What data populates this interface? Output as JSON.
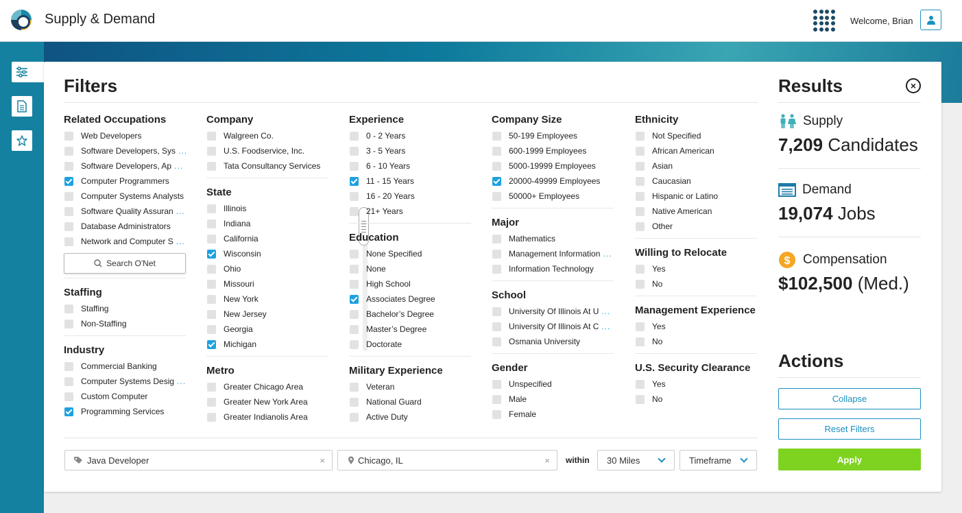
{
  "header": {
    "title": "Supply & Demand",
    "welcome": "Welcome, Brian"
  },
  "filters": {
    "title": "Filters",
    "related_occupations": {
      "title": "Related Occupations",
      "items": [
        {
          "label": "Web Developers",
          "checked": false,
          "more": ""
        },
        {
          "label": "Software Developers, Sys",
          "checked": false,
          "more": "..."
        },
        {
          "label": "Software Developers, Ap",
          "checked": false,
          "more": "..."
        },
        {
          "label": "Computer Programmers",
          "checked": true,
          "more": ""
        },
        {
          "label": "Computer Systems Analysts",
          "checked": false,
          "more": ""
        },
        {
          "label": "Software Quality Assuran",
          "checked": false,
          "more": "..."
        },
        {
          "label": "Database Administrators",
          "checked": false,
          "more": ""
        },
        {
          "label": "Network and Computer S",
          "checked": false,
          "more": "..."
        }
      ],
      "search_label": "Search O'Net"
    },
    "staffing": {
      "title": "Staffing",
      "items": [
        {
          "label": "Staffing",
          "checked": false,
          "more": ""
        },
        {
          "label": "Non-Staffing",
          "checked": false,
          "more": ""
        }
      ]
    },
    "industry": {
      "title": "Industry",
      "items": [
        {
          "label": "Commercial Banking",
          "checked": false,
          "more": ""
        },
        {
          "label": "Computer Systems Desig",
          "checked": false,
          "more": "..."
        },
        {
          "label": "Custom Computer",
          "checked": false,
          "more": ""
        },
        {
          "label": "Programming Services",
          "checked": true,
          "more": ""
        }
      ]
    },
    "company": {
      "title": "Company",
      "items": [
        {
          "label": "Walgreen Co.",
          "checked": false,
          "more": ""
        },
        {
          "label": "U.S. Foodservice, Inc.",
          "checked": false,
          "more": ""
        },
        {
          "label": "Tata Consultancy Services",
          "checked": false,
          "more": ""
        }
      ]
    },
    "state": {
      "title": "State",
      "items": [
        {
          "label": "Illinois",
          "checked": false,
          "more": ""
        },
        {
          "label": "Indiana",
          "checked": false,
          "more": ""
        },
        {
          "label": "California",
          "checked": false,
          "more": ""
        },
        {
          "label": "Wisconsin",
          "checked": true,
          "more": ""
        },
        {
          "label": "Ohio",
          "checked": false,
          "more": ""
        },
        {
          "label": "Missouri",
          "checked": false,
          "more": ""
        },
        {
          "label": "New York",
          "checked": false,
          "more": ""
        },
        {
          "label": "New Jersey",
          "checked": false,
          "more": ""
        },
        {
          "label": "Georgia",
          "checked": false,
          "more": ""
        },
        {
          "label": "Michigan",
          "checked": true,
          "more": ""
        }
      ]
    },
    "metro": {
      "title": "Metro",
      "items": [
        {
          "label": "Greater Chicago Area",
          "checked": false,
          "more": ""
        },
        {
          "label": "Greater New York Area",
          "checked": false,
          "more": ""
        },
        {
          "label": "Greater Indianolis Area",
          "checked": false,
          "more": ""
        }
      ]
    },
    "experience": {
      "title": "Experience",
      "items": [
        {
          "label": "0 - 2 Years",
          "checked": false,
          "more": ""
        },
        {
          "label": "3 - 5 Years",
          "checked": false,
          "more": ""
        },
        {
          "label": "6 - 10 Years",
          "checked": false,
          "more": ""
        },
        {
          "label": "11 - 15  Years",
          "checked": true,
          "more": ""
        },
        {
          "label": "16 - 20 Years",
          "checked": false,
          "more": ""
        },
        {
          "label": "21+ Years",
          "checked": false,
          "more": ""
        }
      ]
    },
    "education": {
      "title": "Education",
      "items": [
        {
          "label": "None Specified",
          "checked": false,
          "more": ""
        },
        {
          "label": "None",
          "checked": false,
          "more": ""
        },
        {
          "label": "High School",
          "checked": false,
          "more": ""
        },
        {
          "label": "Associates Degree",
          "checked": true,
          "more": ""
        },
        {
          "label": "Bachelor’s Degree",
          "checked": false,
          "more": ""
        },
        {
          "label": "Master’s Degree",
          "checked": false,
          "more": ""
        },
        {
          "label": "Doctorate",
          "checked": false,
          "more": ""
        }
      ]
    },
    "military": {
      "title": "Military Experience",
      "items": [
        {
          "label": "Veteran",
          "checked": false,
          "more": ""
        },
        {
          "label": "National Guard",
          "checked": false,
          "more": ""
        },
        {
          "label": "Active Duty",
          "checked": false,
          "more": ""
        }
      ]
    },
    "company_size": {
      "title": "Company Size",
      "items": [
        {
          "label": "50-199 Employees",
          "checked": false,
          "more": ""
        },
        {
          "label": "600-1999 Employees",
          "checked": false,
          "more": ""
        },
        {
          "label": "5000-19999 Employees",
          "checked": false,
          "more": ""
        },
        {
          "label": "20000-49999 Employees",
          "checked": true,
          "more": ""
        },
        {
          "label": "50000+ Employees",
          "checked": false,
          "more": ""
        }
      ]
    },
    "major": {
      "title": "Major",
      "items": [
        {
          "label": "Mathematics",
          "checked": false,
          "more": ""
        },
        {
          "label": "Management Information",
          "checked": false,
          "more": "..."
        },
        {
          "label": "Information Technology",
          "checked": false,
          "more": ""
        }
      ]
    },
    "school": {
      "title": "School",
      "items": [
        {
          "label": "University Of Illinois At U",
          "checked": false,
          "more": "..."
        },
        {
          "label": "University Of Illinois At C",
          "checked": false,
          "more": "..."
        },
        {
          "label": "Osmania University",
          "checked": false,
          "more": ""
        }
      ]
    },
    "gender": {
      "title": "Gender",
      "items": [
        {
          "label": "Unspecified",
          "checked": false,
          "more": ""
        },
        {
          "label": "Male",
          "checked": false,
          "more": ""
        },
        {
          "label": "Female",
          "checked": false,
          "more": ""
        }
      ]
    },
    "ethnicity": {
      "title": "Ethnicity",
      "items": [
        {
          "label": "Not Specified",
          "checked": false,
          "more": ""
        },
        {
          "label": "African American",
          "checked": false,
          "more": ""
        },
        {
          "label": "Asian",
          "checked": false,
          "more": ""
        },
        {
          "label": "Caucasian",
          "checked": false,
          "more": ""
        },
        {
          "label": "Hispanic or Latino",
          "checked": false,
          "more": ""
        },
        {
          "label": "Native American",
          "checked": false,
          "more": ""
        },
        {
          "label": "Other",
          "checked": false,
          "more": ""
        }
      ]
    },
    "relocate": {
      "title": "Willing to Relocate",
      "items": [
        {
          "label": "Yes",
          "checked": false,
          "more": ""
        },
        {
          "label": "No",
          "checked": false,
          "more": ""
        }
      ]
    },
    "management": {
      "title": "Management Experience",
      "items": [
        {
          "label": "Yes",
          "checked": false,
          "more": ""
        },
        {
          "label": "No",
          "checked": false,
          "more": ""
        }
      ]
    },
    "clearance": {
      "title": "U.S. Security Clearance",
      "items": [
        {
          "label": "Yes",
          "checked": false,
          "more": ""
        },
        {
          "label": "No",
          "checked": false,
          "more": ""
        }
      ]
    }
  },
  "search_bar": {
    "keyword": "Java Developer",
    "location": "Chicago, IL",
    "clear_glyph": "×",
    "within_label": "within",
    "distance": "30 Miles",
    "timeframe": "Timeframe"
  },
  "results": {
    "title": "Results",
    "supply_label": "Supply",
    "supply_value": "7,209",
    "supply_unit": "Candidates",
    "demand_label": "Demand",
    "demand_value": "19,074",
    "demand_unit": "Jobs",
    "comp_label": "Compensation",
    "comp_value": "$102,500",
    "comp_unit": "(Med.)"
  },
  "actions": {
    "title": "Actions",
    "collapse": "Collapse",
    "reset": "Reset Filters",
    "apply": "Apply"
  },
  "colors": {
    "accent": "#1b8fc0",
    "apply": "#7ed321",
    "rail": "#1581a1",
    "checked": "#1da1e0",
    "coin": "#f5a623",
    "supply_icon": "#3fb0b8"
  }
}
